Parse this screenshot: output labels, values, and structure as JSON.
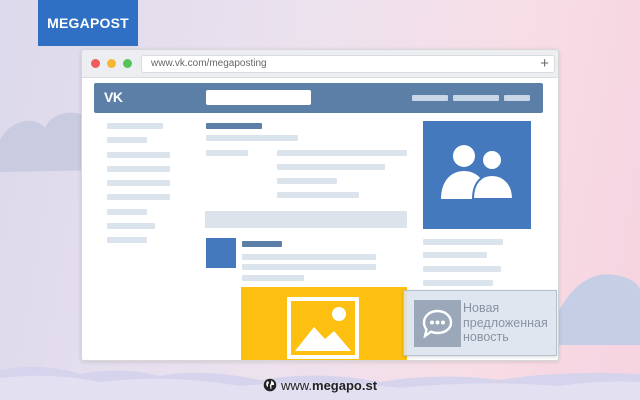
{
  "brand": {
    "label": "MEGAPOST",
    "color": "#2f6fc4"
  },
  "browser": {
    "url": "www.vk.com/megaposting",
    "new_tab_symbol": "+",
    "traffic_lights": [
      "#ef5b5b",
      "#f5b731",
      "#53c45a"
    ]
  },
  "vk": {
    "logo_text": "VK",
    "header_color": "#5b7fa6",
    "accent_blue": "#4479bd",
    "accent_yellow": "#fdc010",
    "group_icon": "two-people-icon",
    "image_icon": "image-placeholder-icon"
  },
  "notification": {
    "icon": "chat-bubble-icon",
    "lines": [
      "Новая",
      "предложенная",
      "новость"
    ]
  },
  "footer": {
    "icon": "globe-icon",
    "text_prefix": "www.",
    "text_bold": "megapo.st"
  }
}
